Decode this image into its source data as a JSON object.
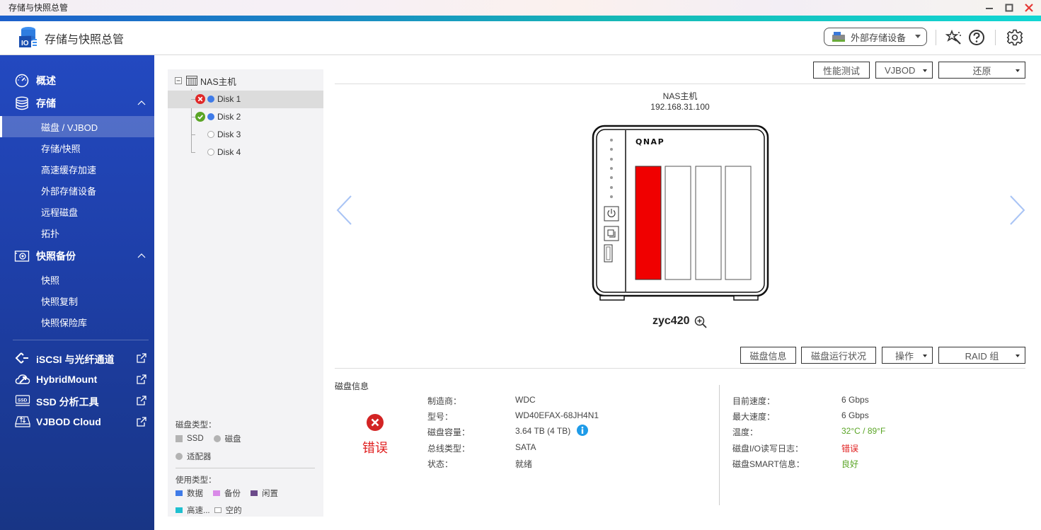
{
  "window": {
    "title": "存储与快照总管",
    "controls": {
      "minimize": "minimize-icon",
      "maximize": "maximize-icon",
      "close": "close-icon"
    }
  },
  "header": {
    "app_title": "存储与快照总管",
    "external_storage_label": "外部存储设备",
    "icons": [
      "storage-app-icon",
      "external-drive-icon",
      "wizard-icon",
      "help-icon",
      "gear-icon"
    ]
  },
  "sidebar": {
    "groups": [
      {
        "label": "概述",
        "icon": "dashboard-icon"
      },
      {
        "label": "存储",
        "icon": "database-icon",
        "expanded": true,
        "items": [
          {
            "label": "磁盘 / VJBOD",
            "active": true
          },
          {
            "label": "存储/快照"
          },
          {
            "label": "高速缓存加速"
          },
          {
            "label": "外部存储设备"
          },
          {
            "label": "远程磁盘"
          },
          {
            "label": "拓扑"
          }
        ]
      },
      {
        "label": "快照备份",
        "icon": "camera-icon",
        "expanded": true,
        "items": [
          {
            "label": "快照"
          },
          {
            "label": "快照复制"
          },
          {
            "label": "快照保险库"
          }
        ]
      }
    ],
    "external_links": [
      {
        "label": "iSCSI 与光纤通道",
        "icon": "iscsi-icon"
      },
      {
        "label": "HybridMount",
        "icon": "cloud-mount-icon"
      },
      {
        "label": "SSD 分析工具",
        "icon": "ssd-icon"
      },
      {
        "label": "VJBOD Cloud",
        "icon": "vjbod-cloud-icon"
      }
    ]
  },
  "tree": {
    "root": "NAS主机",
    "disks": [
      {
        "label": "Disk 1",
        "status": "error",
        "usage": "data",
        "selected": true
      },
      {
        "label": "Disk 2",
        "status": "ok",
        "usage": "data"
      },
      {
        "label": "Disk 3",
        "status": "none",
        "usage": "empty"
      },
      {
        "label": "Disk 4",
        "status": "none",
        "usage": "empty"
      }
    ],
    "legend": {
      "disk_type_title": "磁盘类型：",
      "disk_types": [
        {
          "label": "SSD",
          "shape": "square"
        },
        {
          "label": "磁盘",
          "shape": "circle"
        },
        {
          "label": "适配器",
          "shape": "circle"
        }
      ],
      "usage_type_title": "使用类型：",
      "usage_types": [
        {
          "label": "数据",
          "color": "#3f7be8"
        },
        {
          "label": "备份",
          "color": "#d98ae8"
        },
        {
          "label": "闲置",
          "color": "#6b4a8a"
        },
        {
          "label": "高速...",
          "color": "#1fc0d0"
        },
        {
          "label": "空的",
          "color": "#ffffff"
        }
      ]
    }
  },
  "toolbar": {
    "benchmark": "性能测试",
    "vjbod": "VJBOD",
    "restore": "还原"
  },
  "device": {
    "name": "NAS主机",
    "ip": "192.168.31.100",
    "brand": "QNAP",
    "hostname": "zyc420",
    "bays": [
      {
        "bay": 1,
        "state": "error"
      },
      {
        "bay": 2,
        "state": "empty"
      },
      {
        "bay": 3,
        "state": "empty"
      },
      {
        "bay": 4,
        "state": "empty"
      }
    ]
  },
  "disk_toolbar": {
    "disk_info": "磁盘信息",
    "disk_health": "磁盘运行状况",
    "action": "操作",
    "raid_group": "RAID 组"
  },
  "disk_info": {
    "section_title": "磁盘信息",
    "status_label": "错误",
    "left": [
      {
        "label": "制造商：",
        "value": "WDC"
      },
      {
        "label": "型号：",
        "value": "WD40EFAX-68JH4N1"
      },
      {
        "label": "磁盘容量：",
        "value": "3.64 TB (4 TB)"
      },
      {
        "label": "总线类型：",
        "value": "SATA"
      },
      {
        "label": "状态：",
        "value": "就绪"
      }
    ],
    "right": [
      {
        "label": "目前速度：",
        "value": "6 Gbps"
      },
      {
        "label": "最大速度：",
        "value": "6 Gbps"
      },
      {
        "label": "温度：",
        "value": "32°C / 89°F",
        "tone": "good"
      },
      {
        "label": "磁盘I/O读写日志：",
        "value": "错误",
        "tone": "bad"
      },
      {
        "label": "磁盘SMART信息：",
        "value": "良好",
        "tone": "good"
      }
    ]
  },
  "colors": {
    "sidebar_top": "#2349c0",
    "sidebar_bottom": "#183585",
    "error": "#e02020",
    "ok": "#5aa526",
    "info": "#1e9be8",
    "bay_error": "#f00000"
  }
}
